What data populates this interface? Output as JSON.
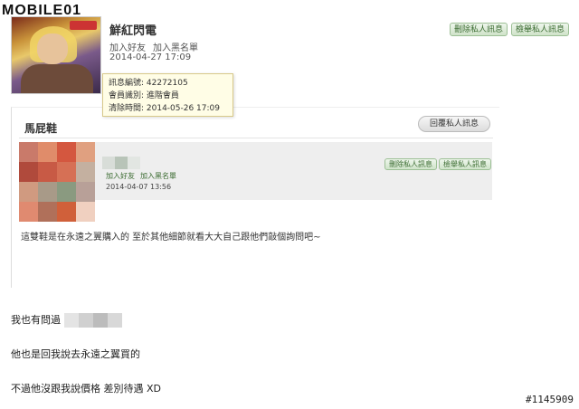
{
  "site": {
    "logo_text": "MOBILE01"
  },
  "message": {
    "sender_name": "鮮紅閃電",
    "add_friend": "加入好友",
    "add_blacklist": "加入黑名單",
    "date": "2014-04-27 17:09",
    "delete_label": "刪除私人訊息",
    "report_label": "檢舉私人訊息"
  },
  "tooltip": {
    "msg_id": "訊息編號: 42272105",
    "member": "會員識別: 進階會員",
    "clear_time": "清除時間: 2014-05-26 17:09"
  },
  "inner": {
    "title": "馬屁鞋",
    "reply_label": "回覆私人訊息",
    "add_friend": "加入好友",
    "add_blacklist": "加入黑名單",
    "date": "2014-04-07 13:56",
    "delete_label": "刪除私人訊息",
    "report_label": "檢舉私人訊息",
    "body": "這雙鞋是在永遠之翼購入的 至於其他細節就看大大自己跟他們敲個詢問吧~",
    "avatar_colors": [
      "#c97a6a",
      "#e08c6a",
      "#d4573f",
      "#e0a080",
      "#b04a3c",
      "#c85a45",
      "#d67055",
      "#c4b0a0",
      "#d09a80",
      "#a89a88",
      "#8a9a80",
      "#b8a098",
      "#e08a70",
      "#b0705a",
      "#d0603a",
      "#f0d0c0"
    ]
  },
  "reply": {
    "line1": "我也有問過",
    "line2": "他也是回我說去永遠之翼買的",
    "line3": "不過他沒跟我說價格 差別待遇 XD",
    "blur_colors": [
      "#e4e4e4",
      "#d0d0d0",
      "#bcbcbc",
      "#d8d8d8"
    ]
  },
  "watermark": "#1145909"
}
